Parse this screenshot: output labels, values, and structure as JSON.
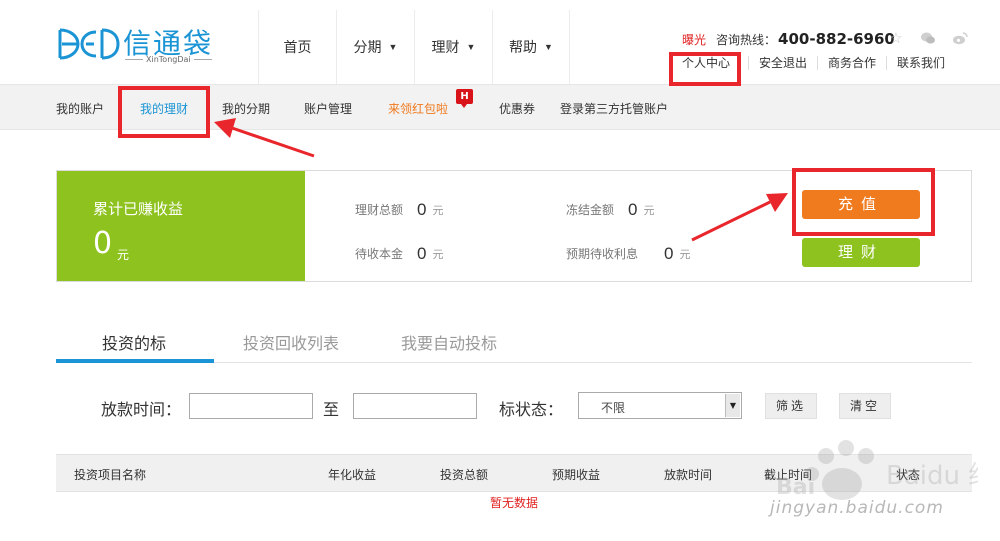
{
  "logo": {
    "brand": "信通袋",
    "sub": "XinTongDai"
  },
  "mainnav": [
    {
      "label": "首页",
      "caret": false
    },
    {
      "label": "分期",
      "caret": true
    },
    {
      "label": "理财",
      "caret": true
    },
    {
      "label": "帮助",
      "caret": true
    }
  ],
  "header": {
    "exposure": "曝光",
    "hotline_label": "咨询热线：",
    "hotline_number": "400-882-6960",
    "icons": [
      "star-icon",
      "wechat-icon",
      "weibo-icon"
    ],
    "links": [
      "个人中心",
      "安全退出",
      "商务合作",
      "联系我们"
    ]
  },
  "subnav": {
    "items": [
      "我的账户",
      "我的理财",
      "我的分期",
      "账户管理",
      "来领红包啦",
      "优惠券",
      "登录第三方托管账户"
    ],
    "active": "我的理财",
    "badge": "H"
  },
  "summary": {
    "earned_label": "累计已赚收益",
    "earned_value": "0",
    "earned_unit": "元",
    "stats": [
      {
        "label": "理财总额",
        "value": "0",
        "unit": "元"
      },
      {
        "label": "冻结金额",
        "value": "0",
        "unit": "元"
      },
      {
        "label": "待收本金",
        "value": "0",
        "unit": "元"
      },
      {
        "label": "预期待收利息",
        "value": "0",
        "unit": "元"
      }
    ],
    "recharge_label": "充值",
    "invest_label": "理财"
  },
  "tabs": [
    "投资的标",
    "投资回收列表",
    "我要自动投标"
  ],
  "filter": {
    "date_label": "放款时间：",
    "to_label": "至",
    "status_label": "标状态：",
    "status_value": "不限",
    "filter_button": "筛选",
    "clear_button": "清空"
  },
  "table": {
    "columns": [
      "投资项目名称",
      "年化收益",
      "投资总额",
      "预期收益",
      "放款时间",
      "截止时间",
      "状态"
    ],
    "empty": "暂无数据"
  },
  "watermark": {
    "text": "jingyan.baidu.com",
    "brand": "Baidu 经验"
  },
  "colors": {
    "brand_blue": "#1a94d4",
    "green": "#8dc21f",
    "orange": "#f07a1e",
    "annotation_red": "#e8262b"
  }
}
